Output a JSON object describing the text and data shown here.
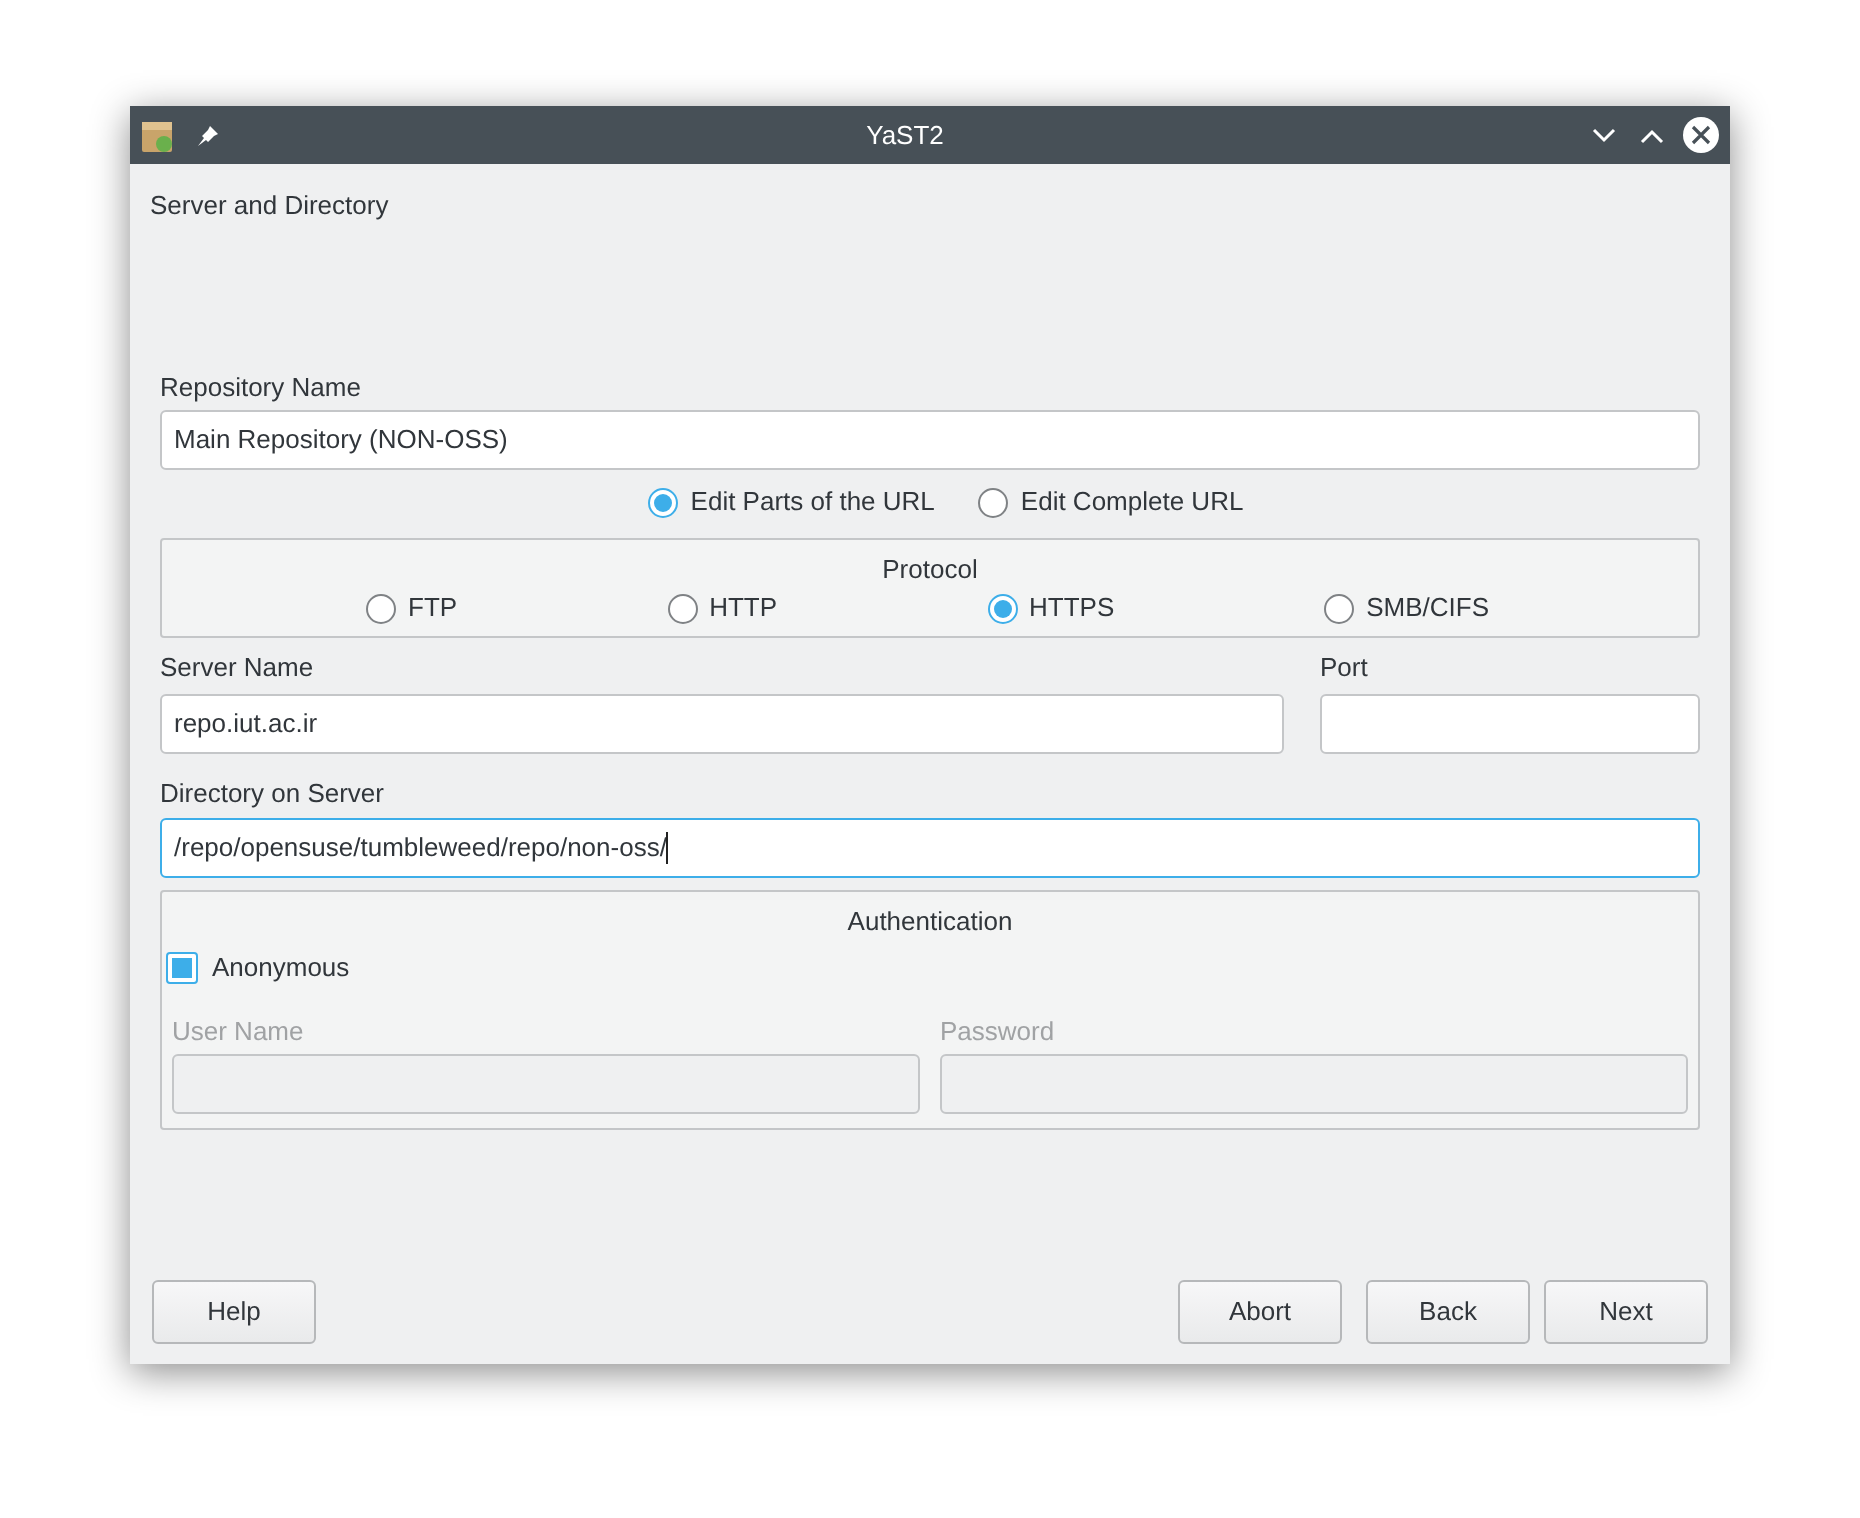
{
  "window": {
    "title": "YaST2"
  },
  "heading": "Server and Directory",
  "repository_name": {
    "label": "Repository Name",
    "value": "Main Repository (NON-OSS)"
  },
  "url_mode": [
    {
      "label": "Edit Parts of the URL",
      "selected": true
    },
    {
      "label": "Edit Complete URL",
      "selected": false
    }
  ],
  "protocol": {
    "title": "Protocol",
    "options": [
      {
        "label": "FTP",
        "selected": false
      },
      {
        "label": "HTTP",
        "selected": false
      },
      {
        "label": "HTTPS",
        "selected": true
      },
      {
        "label": "SMB/CIFS",
        "selected": false
      }
    ]
  },
  "server_name": {
    "label": "Server Name",
    "value": "repo.iut.ac.ir"
  },
  "port": {
    "label": "Port"
  },
  "directory": {
    "label": "Directory on Server",
    "value": "/repo/opensuse/tumbleweed/repo/non-oss/",
    "focused": true
  },
  "authentication": {
    "title": "Authentication",
    "anonymous": {
      "label": "Anonymous",
      "checked": true
    },
    "fields": [
      {
        "label": "User Name",
        "disabled": true
      },
      {
        "label": "Password",
        "disabled": true
      }
    ]
  },
  "buttons": {
    "left": [
      "Help"
    ],
    "right": [
      "Abort",
      "Back",
      "Next"
    ]
  }
}
